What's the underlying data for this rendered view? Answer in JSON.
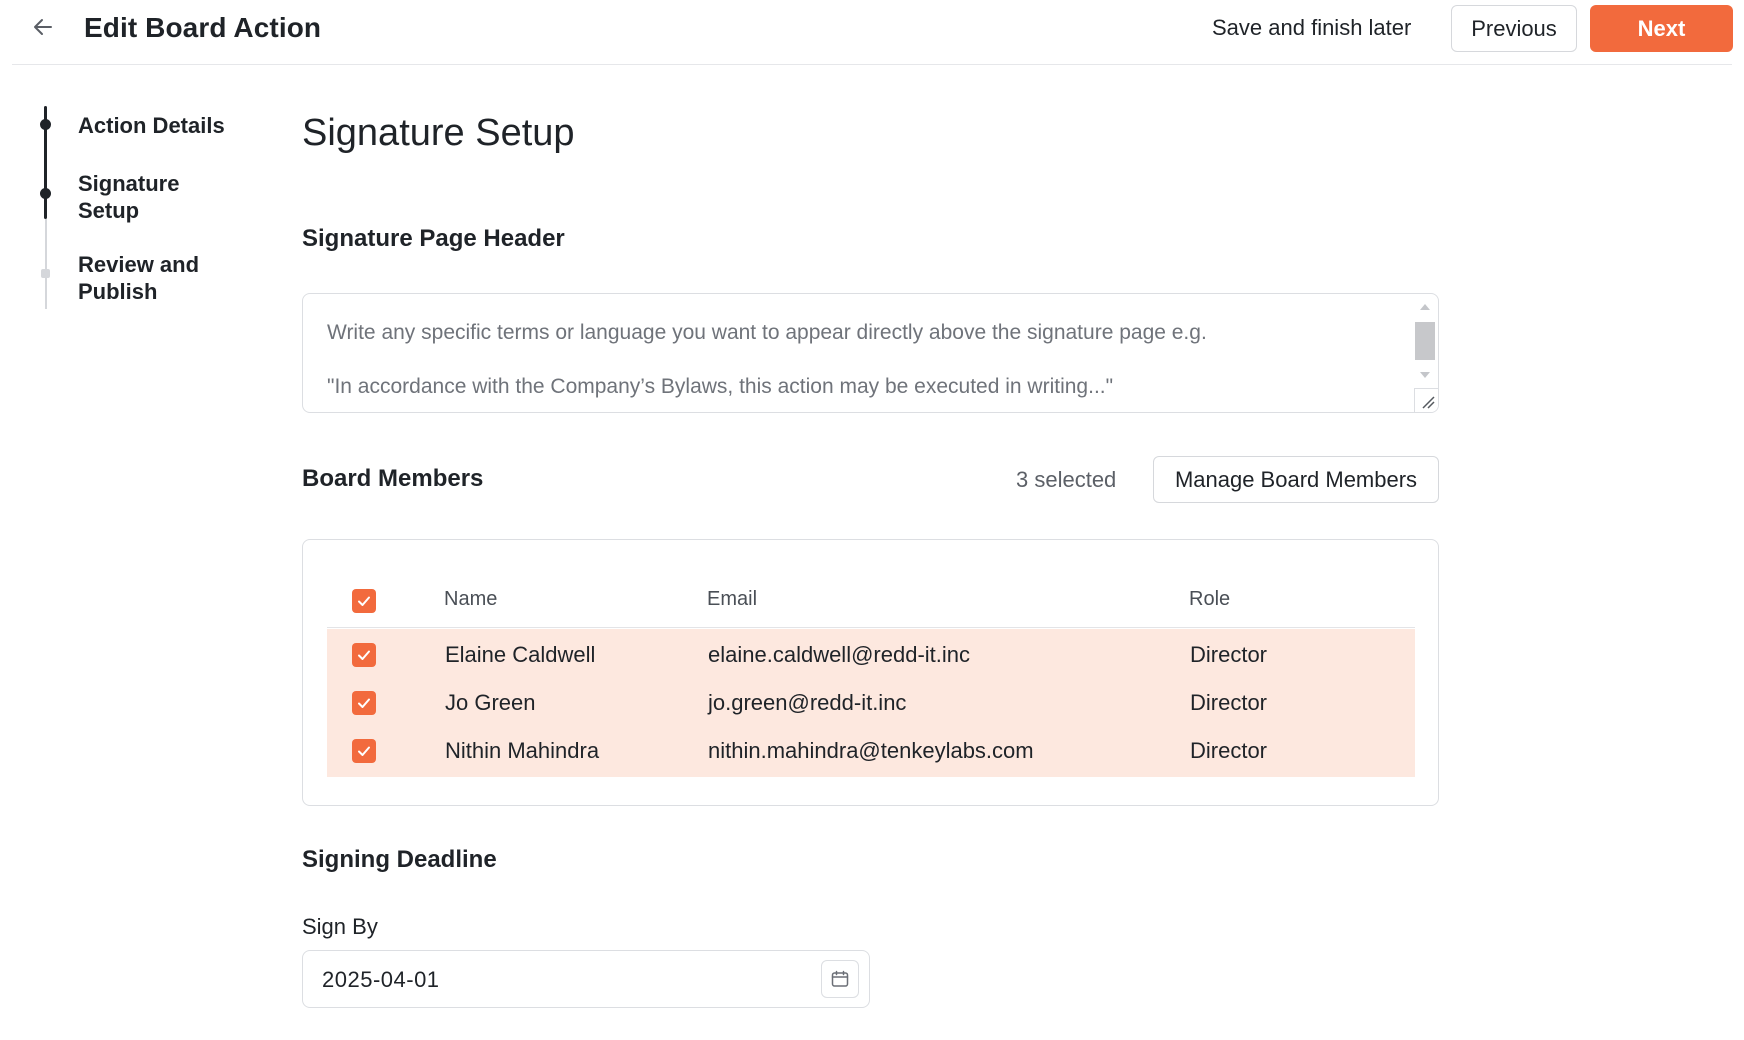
{
  "header": {
    "title": "Edit Board Action",
    "save_later": "Save and finish later",
    "previous": "Previous",
    "next": "Next",
    "accent": "#f26a3d"
  },
  "stepper": {
    "steps": [
      {
        "label_line1": "Action Details",
        "label_line2": "",
        "state": "complete"
      },
      {
        "label_line1": "Signature",
        "label_line2": "Setup",
        "state": "current"
      },
      {
        "label_line1": "Review and",
        "label_line2": "Publish",
        "state": "upcoming"
      }
    ]
  },
  "main": {
    "title": "Signature Setup",
    "signature_header": {
      "heading": "Signature Page Header",
      "placeholder_line1": "Write any specific terms or language you want to appear directly above the signature page e.g.",
      "placeholder_line2": "\"In accordance with the Company’s Bylaws, this action may be executed in writing...\""
    },
    "board_members": {
      "heading": "Board Members",
      "selected_count": "3 selected",
      "manage_button": "Manage Board Members",
      "columns": {
        "name": "Name",
        "email": "Email",
        "role": "Role"
      },
      "rows": [
        {
          "name": "Elaine Caldwell",
          "email": "elaine.caldwell@redd-it.inc",
          "role": "Director",
          "checked": true
        },
        {
          "name": "Jo Green",
          "email": "jo.green@redd-it.inc",
          "role": "Director",
          "checked": true
        },
        {
          "name": "Nithin Mahindra",
          "email": "nithin.mahindra@tenkeylabs.com",
          "role": "Director",
          "checked": true
        }
      ]
    },
    "deadline": {
      "heading": "Signing Deadline",
      "sign_by_label": "Sign By",
      "sign_by_value": "2025-04-01"
    }
  }
}
